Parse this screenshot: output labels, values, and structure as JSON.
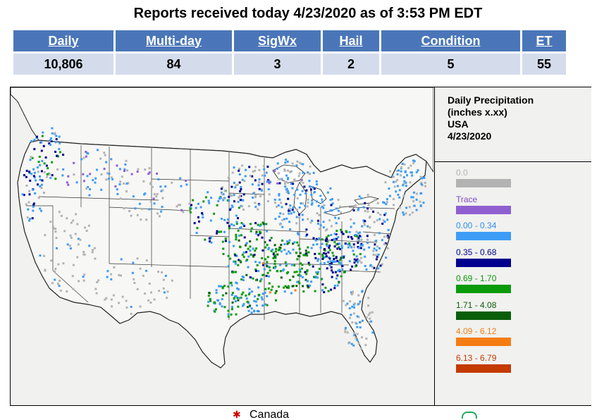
{
  "title": "Reports received today 4/23/2020 as of 3:53 PM EDT",
  "report_table": {
    "headers": [
      "Daily",
      "Multi-day",
      "SigWx",
      "Hail",
      "Condition",
      "ET"
    ],
    "values": [
      "10,806",
      "84",
      "3",
      "2",
      "5",
      "55"
    ]
  },
  "legend": {
    "title_lines": [
      "Daily Precipitation",
      "(inches  x.xx)",
      "USA",
      "4/23/2020"
    ],
    "items": [
      {
        "label": "0.0",
        "color": "#b3b3b3",
        "text_color": "#b3b3b3"
      },
      {
        "label": "Trace",
        "color": "#8f5fd0",
        "text_color": "#7a4cc4"
      },
      {
        "label": "0.00 - 0.34",
        "color": "#3d9cf5",
        "text_color": "#2f8ef0"
      },
      {
        "label": "0.35 - 0.68",
        "color": "#00008e",
        "text_color": "#00008e"
      },
      {
        "label": "0.69 - 1.70",
        "color": "#0a9a0a",
        "text_color": "#0a9a0a"
      },
      {
        "label": "1.71 - 4.08",
        "color": "#0a5e0a",
        "text_color": "#0a5e0a"
      },
      {
        "label": "4.09 - 6.12",
        "color": "#f57c12",
        "text_color": "#f57c12"
      },
      {
        "label": "6.13 - 6.79",
        "color": "#c43a00",
        "text_color": "#c43a00"
      }
    ]
  },
  "bottom": {
    "canada_label": "Canada"
  }
}
